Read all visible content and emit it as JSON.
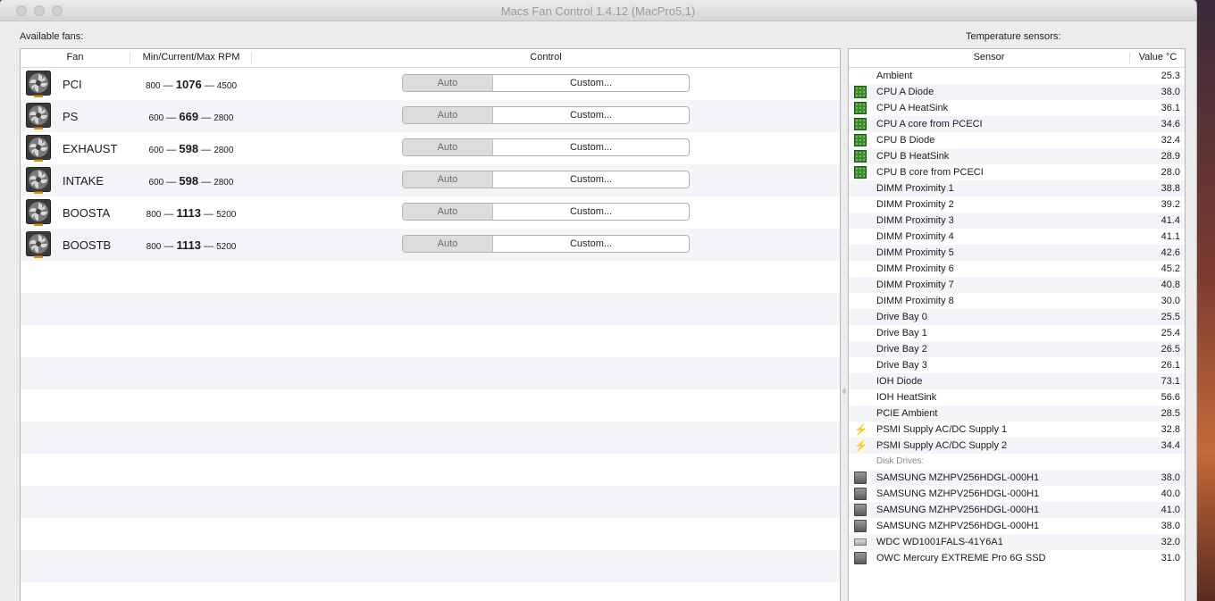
{
  "window": {
    "title": "Macs Fan Control 1.4.12 (MacPro5,1)"
  },
  "fans_section": {
    "label": "Available fans:",
    "columns": {
      "fan": "Fan",
      "rpm": "Min/Current/Max RPM",
      "control": "Control"
    },
    "items": [
      {
        "name": "PCI",
        "min": "800",
        "current": "1076",
        "max": "4500",
        "auto_label": "Auto",
        "custom_label": "Custom..."
      },
      {
        "name": "PS",
        "min": "600",
        "current": "669",
        "max": "2800",
        "auto_label": "Auto",
        "custom_label": "Custom..."
      },
      {
        "name": "EXHAUST",
        "min": "600",
        "current": "598",
        "max": "2800",
        "auto_label": "Auto",
        "custom_label": "Custom..."
      },
      {
        "name": "INTAKE",
        "min": "600",
        "current": "598",
        "max": "2800",
        "auto_label": "Auto",
        "custom_label": "Custom..."
      },
      {
        "name": "BOOSTA",
        "min": "800",
        "current": "1113",
        "max": "5200",
        "auto_label": "Auto",
        "custom_label": "Custom..."
      },
      {
        "name": "BOOSTB",
        "min": "800",
        "current": "1113",
        "max": "5200",
        "auto_label": "Auto",
        "custom_label": "Custom..."
      }
    ]
  },
  "temps_section": {
    "label": "Temperature sensors:",
    "columns": {
      "sensor": "Sensor",
      "value": "Value °C"
    },
    "rows": [
      {
        "kind": "sensor",
        "icon": "none",
        "name": "Ambient",
        "value": "25.3"
      },
      {
        "kind": "sensor",
        "icon": "cpu-chip-icon",
        "name": "CPU A Diode",
        "value": "38.0"
      },
      {
        "kind": "sensor",
        "icon": "cpu-chip-icon",
        "name": "CPU A HeatSink",
        "value": "36.1"
      },
      {
        "kind": "sensor",
        "icon": "cpu-chip-icon",
        "name": "CPU A core from PCECI",
        "value": "34.6"
      },
      {
        "kind": "sensor",
        "icon": "cpu-chip-icon",
        "name": "CPU B Diode",
        "value": "32.4"
      },
      {
        "kind": "sensor",
        "icon": "cpu-chip-icon",
        "name": "CPU B HeatSink",
        "value": "28.9"
      },
      {
        "kind": "sensor",
        "icon": "cpu-chip-icon",
        "name": "CPU B core from PCECI",
        "value": "28.0"
      },
      {
        "kind": "sensor",
        "icon": "none",
        "name": "DIMM Proximity 1",
        "value": "38.8"
      },
      {
        "kind": "sensor",
        "icon": "none",
        "name": "DIMM Proximity 2",
        "value": "39.2"
      },
      {
        "kind": "sensor",
        "icon": "none",
        "name": "DIMM Proximity 3",
        "value": "41.4"
      },
      {
        "kind": "sensor",
        "icon": "none",
        "name": "DIMM Proximity 4",
        "value": "41.1"
      },
      {
        "kind": "sensor",
        "icon": "none",
        "name": "DIMM Proximity 5",
        "value": "42.6"
      },
      {
        "kind": "sensor",
        "icon": "none",
        "name": "DIMM Proximity 6",
        "value": "45.2"
      },
      {
        "kind": "sensor",
        "icon": "none",
        "name": "DIMM Proximity 7",
        "value": "40.8"
      },
      {
        "kind": "sensor",
        "icon": "none",
        "name": "DIMM Proximity 8",
        "value": "30.0"
      },
      {
        "kind": "sensor",
        "icon": "none",
        "name": "Drive Bay 0",
        "value": "25.5"
      },
      {
        "kind": "sensor",
        "icon": "none",
        "name": "Drive Bay 1",
        "value": "25.4"
      },
      {
        "kind": "sensor",
        "icon": "none",
        "name": "Drive Bay 2",
        "value": "26.5"
      },
      {
        "kind": "sensor",
        "icon": "none",
        "name": "Drive Bay 3",
        "value": "26.1"
      },
      {
        "kind": "sensor",
        "icon": "none",
        "name": "IOH Diode",
        "value": "73.1"
      },
      {
        "kind": "sensor",
        "icon": "none",
        "name": "IOH HeatSink",
        "value": "56.6"
      },
      {
        "kind": "sensor",
        "icon": "none",
        "name": "PCIE Ambient",
        "value": "28.5"
      },
      {
        "kind": "sensor",
        "icon": "power-bolt-icon",
        "name": "PSMI Supply AC/DC Supply 1",
        "value": "32.8"
      },
      {
        "kind": "sensor",
        "icon": "power-bolt-icon",
        "name": "PSMI Supply AC/DC Supply 2",
        "value": "34.4"
      },
      {
        "kind": "group",
        "name": "Disk Drives:"
      },
      {
        "kind": "sensor",
        "icon": "hard-drive-icon",
        "name": "SAMSUNG MZHPV256HDGL-000H1",
        "value": "38.0"
      },
      {
        "kind": "sensor",
        "icon": "hard-drive-icon",
        "name": "SAMSUNG MZHPV256HDGL-000H1",
        "value": "40.0"
      },
      {
        "kind": "sensor",
        "icon": "hard-drive-icon",
        "name": "SAMSUNG MZHPV256HDGL-000H1",
        "value": "41.0"
      },
      {
        "kind": "sensor",
        "icon": "hard-drive-icon",
        "name": "SAMSUNG MZHPV256HDGL-000H1",
        "value": "38.0"
      },
      {
        "kind": "sensor",
        "icon": "disk-drive-flat-icon",
        "name": "WDC WD1001FALS-41Y6A1",
        "value": "32.0"
      },
      {
        "kind": "sensor",
        "icon": "hard-drive-icon",
        "name": "OWC Mercury EXTREME Pro 6G SSD",
        "value": "31.0"
      }
    ]
  }
}
